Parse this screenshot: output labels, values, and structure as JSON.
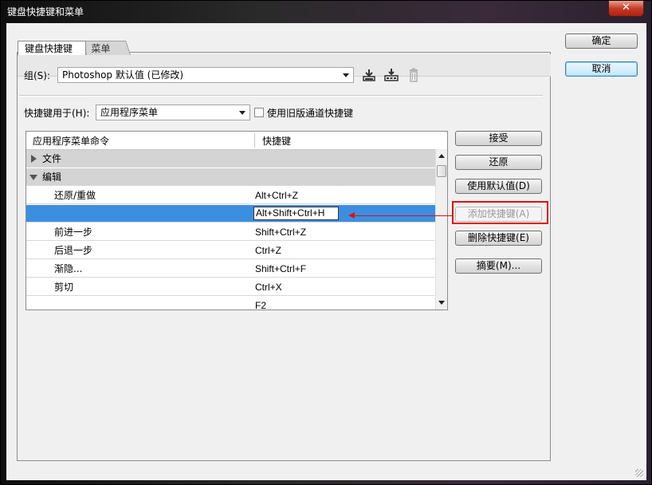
{
  "window": {
    "title": "键盘快捷键和菜单",
    "close_glyph": "✕"
  },
  "tabs": [
    {
      "label": "键盘快捷键",
      "active": true
    },
    {
      "label": "菜单",
      "active": false
    }
  ],
  "set": {
    "label": "组(S):",
    "value": "Photoshop 默认值 (已修改)",
    "icons": [
      "save-set-icon",
      "save-set-as-icon",
      "delete-set-icon"
    ]
  },
  "shortcuts_for": {
    "label": "快捷键用于(H):",
    "value": "应用程序菜单",
    "legacy_label": "使用旧版通道快捷键",
    "legacy_checked": false
  },
  "table": {
    "headers": [
      "应用程序菜单命令",
      "快捷键"
    ],
    "rows": [
      {
        "cmd": "文件",
        "key": "",
        "type": "group-collapsed"
      },
      {
        "cmd": "编辑",
        "key": "",
        "type": "group-expanded"
      },
      {
        "cmd": "还原/重做",
        "key": "Alt+Ctrl+Z",
        "type": "item"
      },
      {
        "cmd": "",
        "key": "Alt+Shift+Ctrl+H",
        "type": "selected-editing"
      },
      {
        "cmd": "前进一步",
        "key": "Shift+Ctrl+Z",
        "type": "item"
      },
      {
        "cmd": "后退一步",
        "key": "Ctrl+Z",
        "type": "item"
      },
      {
        "cmd": "渐隐...",
        "key": "Shift+Ctrl+F",
        "type": "item"
      },
      {
        "cmd": "剪切",
        "key": "Ctrl+X",
        "type": "item"
      },
      {
        "cmd": "",
        "key": "F2",
        "type": "item"
      }
    ]
  },
  "side_buttons": {
    "accept": "接受",
    "undo": "还原",
    "use_default": "使用默认值(D)",
    "add_shortcut": "添加快捷键(A)",
    "delete_shortcut": "删除快捷键(E)",
    "summarize": "摘要(M)..."
  },
  "dialog_buttons": {
    "ok": "确定",
    "cancel": "取消"
  },
  "colors": {
    "selection": "#3c8fe0",
    "annotation": "#e01010"
  }
}
